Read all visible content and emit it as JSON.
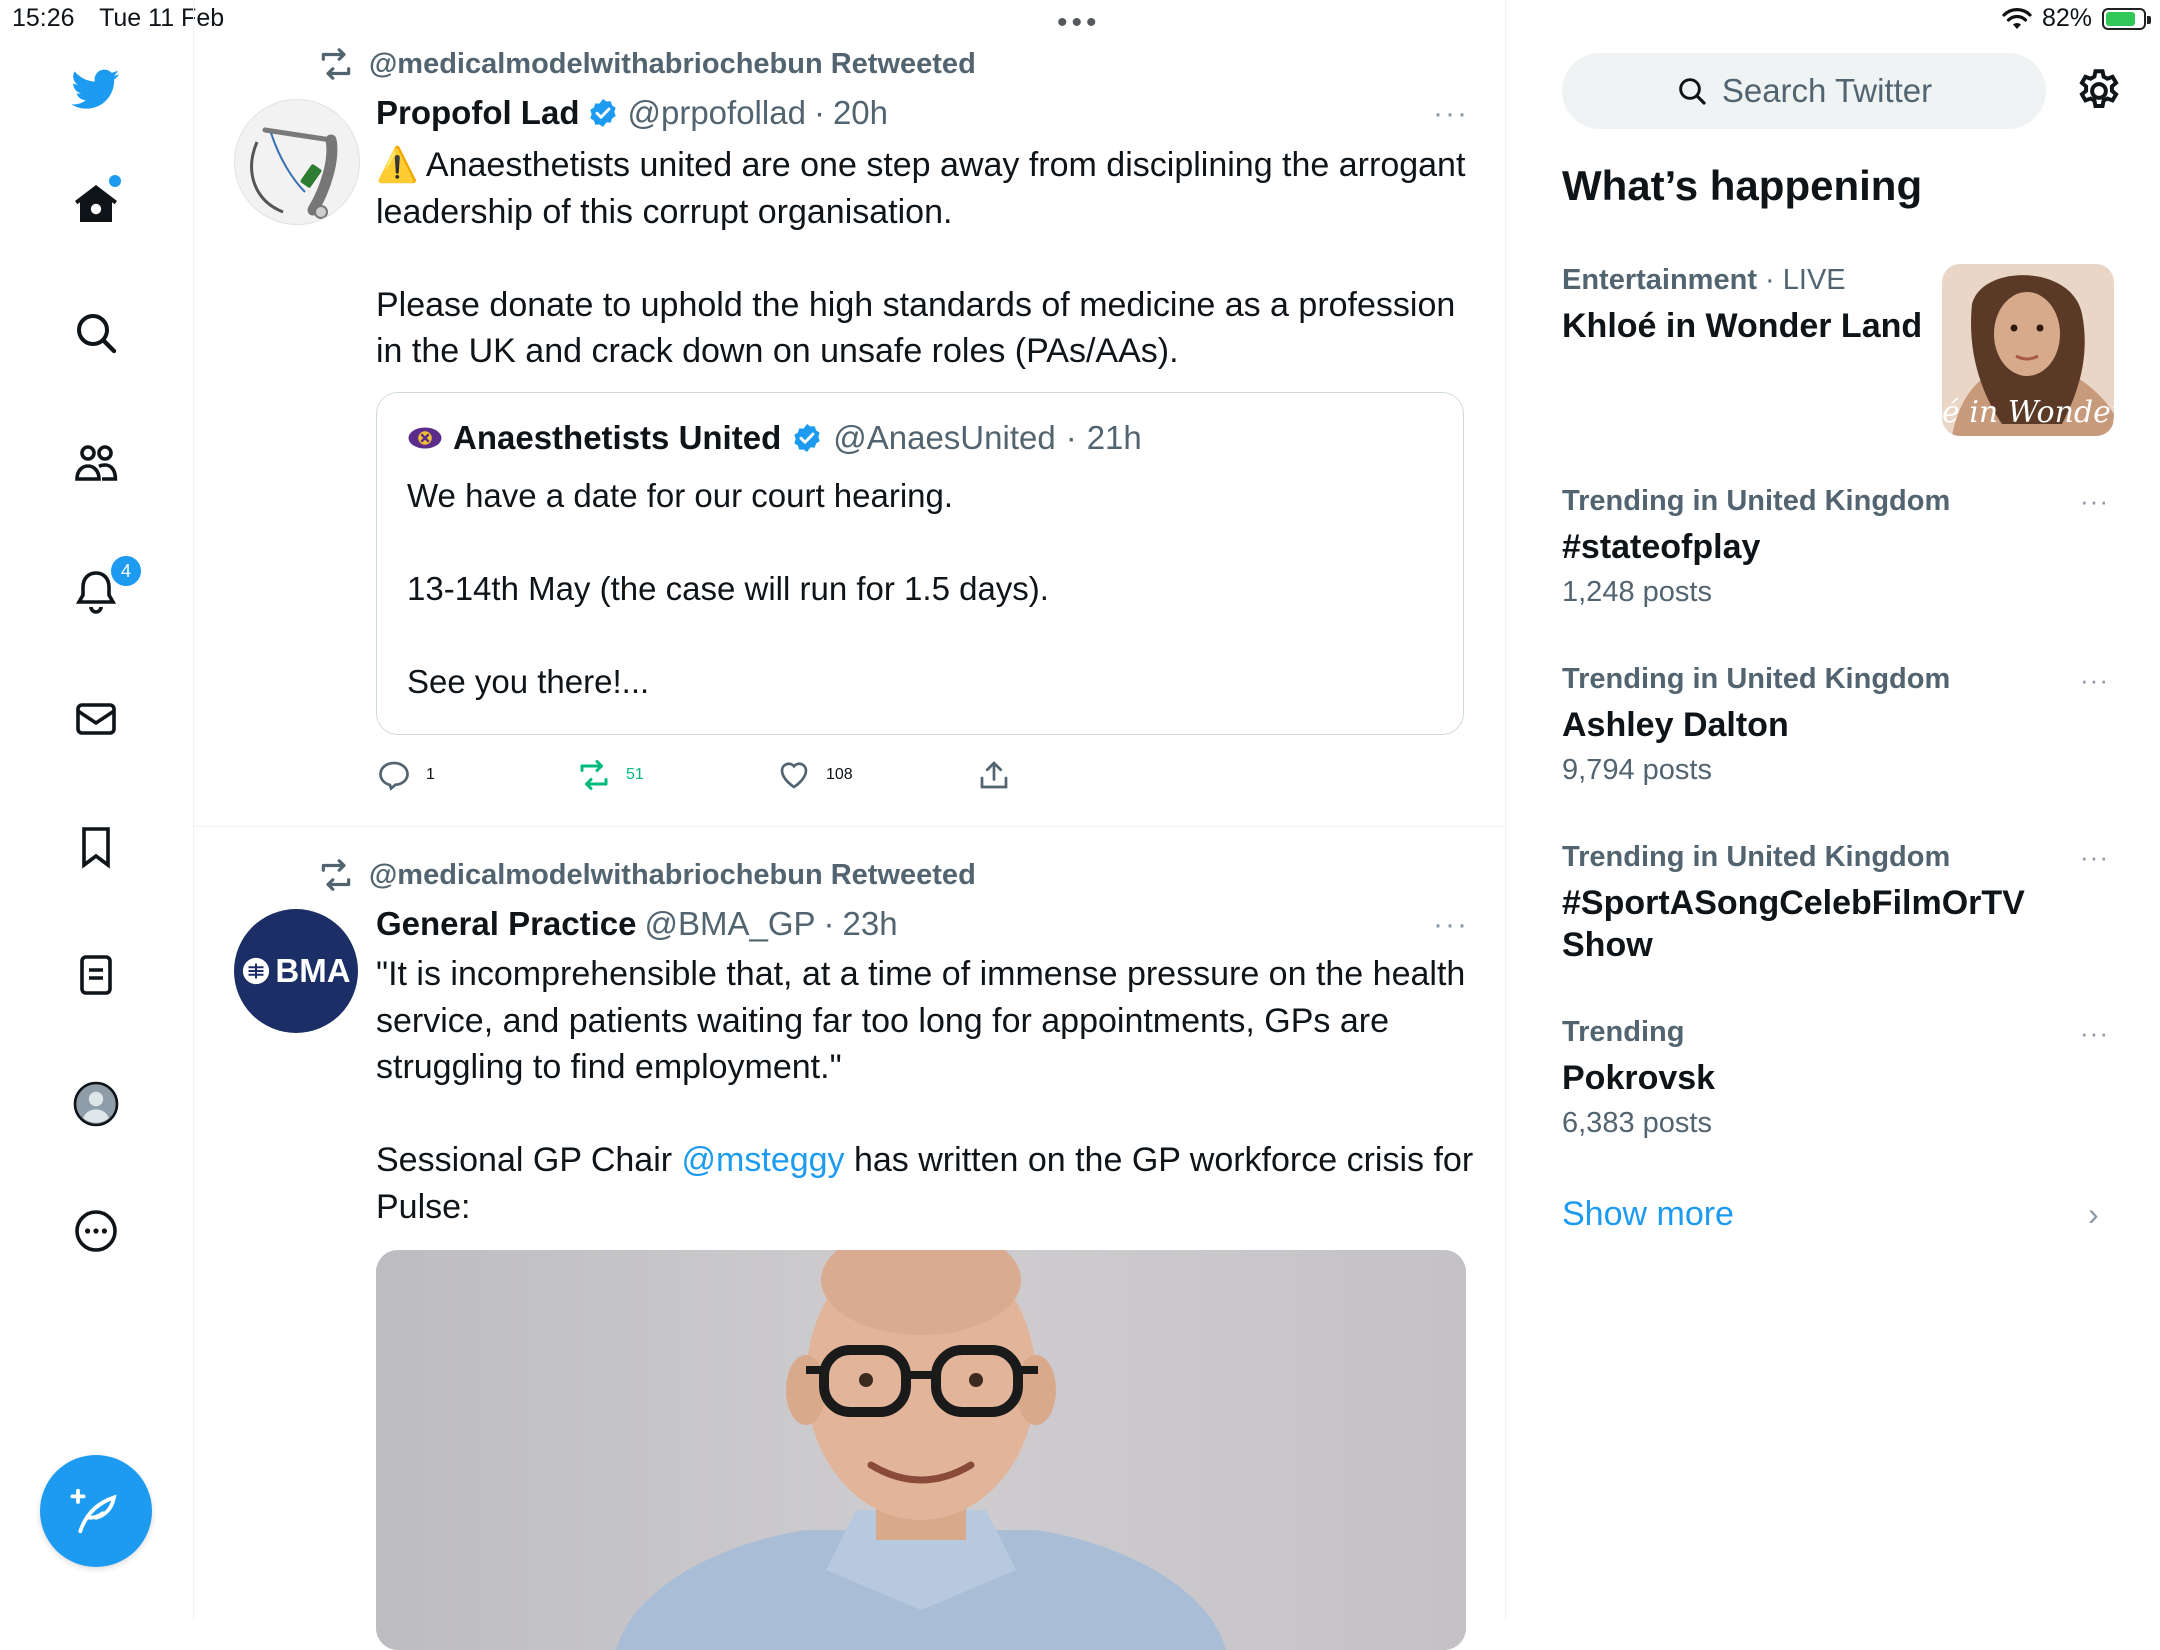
{
  "status_bar": {
    "time": "15:26",
    "date": "Tue 11 Feb",
    "battery_percent": "82%",
    "battery_level": 0.82,
    "multitask_indicator": "•••"
  },
  "nav": {
    "items": [
      {
        "name": "twitter-logo-icon"
      },
      {
        "name": "home-icon"
      },
      {
        "name": "search-icon"
      },
      {
        "name": "communities-icon"
      },
      {
        "name": "notifications-icon"
      },
      {
        "name": "messages-icon"
      },
      {
        "name": "bookmarks-icon"
      },
      {
        "name": "lists-icon"
      },
      {
        "name": "profile-icon"
      },
      {
        "name": "more-icon"
      }
    ],
    "notifications_badge": "4",
    "compose_icon": "compose-quill-icon"
  },
  "colors": {
    "accent": "#1d9bf0",
    "text": "#0f1419",
    "secondary": "#536471",
    "retweet_green": "#00ba7c",
    "bma_navy": "#1b2f66"
  },
  "tweets": [
    {
      "retweeted_by": "@medicalmodelwithabriochebun Retweeted",
      "author_name": "Propofol Lad",
      "author_handle": "@prpofollad",
      "sep": "·",
      "time": "20h",
      "more": "···",
      "text_warning": "⚠️",
      "text": " Anaesthetists united are one step away from disciplining the arrogant leadership of this corrupt organisation.\n\nPlease donate to uphold the high standards of medicine as a profession in the UK and crack down on unsafe roles (PAs/AAs).",
      "quote": {
        "author_name": "Anaesthetists United",
        "author_handle": "@AnaesUnited",
        "sep": "·",
        "time": "21h",
        "text": "We have a date for our court hearing.\n\n13-14th May (the case will run for 1.5 days).\n\nSee you there!..."
      },
      "replies": "1",
      "retweets": "51",
      "likes": "108"
    },
    {
      "retweeted_by": "@medicalmodelwithabriochebun Retweeted",
      "author_name": "General Practice",
      "author_handle": "@BMA_GP",
      "sep": "·",
      "time": "23h",
      "more": "···",
      "avatar_text": "BMA",
      "text": "\"It is incomprehensible that, at a time of immense pressure on the health service, and patients waiting far too long for appointments, GPs are struggling to find employment.\"\n\nSessional GP Chair ",
      "mention": "@msteggy",
      "text_after": " has written on the GP workforce crisis for Pulse:"
    }
  ],
  "sidebar": {
    "search_placeholder": "Search Twitter",
    "title": "What’s happening",
    "trends": [
      {
        "category": "Entertainment",
        "extra": "· LIVE",
        "name": "Khloé in Wonder Land",
        "thumb_caption": "é in Wonder L"
      },
      {
        "category": "Trending in United Kingdom",
        "name": "#stateofplay",
        "count": "1,248 posts"
      },
      {
        "category": "Trending in United Kingdom",
        "name": "Ashley Dalton",
        "count": "9,794 posts"
      },
      {
        "category": "Trending in United Kingdom",
        "name": "#SportASongCelebFilmOrTVShow",
        "count": ""
      },
      {
        "category": "Trending",
        "name": "Pokrovsk",
        "count": "6,383 posts"
      }
    ],
    "trend_more": "···",
    "show_more": "Show more",
    "chevron": "›"
  }
}
